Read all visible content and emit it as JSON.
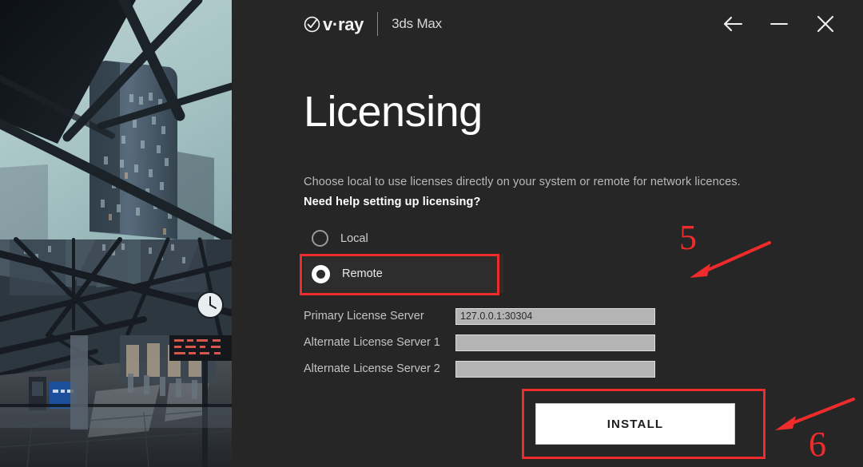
{
  "titlebar": {
    "brand_name": "v·ray",
    "brand_logo_icon": "vray-check-circle-icon",
    "product": "3ds Max",
    "back_icon": "back-arrow-icon",
    "minimize_icon": "minimize-icon",
    "close_icon": "close-icon"
  },
  "page": {
    "title": "Licensing",
    "description": "Choose local to use licenses directly on your system or remote for network licences.",
    "help_link": "Need help setting up licensing?"
  },
  "license_mode": {
    "options": [
      {
        "label": "Local",
        "selected": false
      },
      {
        "label": "Remote",
        "selected": true
      }
    ]
  },
  "servers": [
    {
      "label": "Primary License Server",
      "value": "127.0.0.1:30304",
      "placeholder": ""
    },
    {
      "label": "Alternate License Server 1",
      "value": "",
      "placeholder": ""
    },
    {
      "label": "Alternate License Server 2",
      "value": "",
      "placeholder": ""
    }
  ],
  "actions": {
    "install_label": "INSTALL"
  },
  "annotations": [
    {
      "id": "5",
      "label": "5",
      "target": "remote-radio"
    },
    {
      "id": "6",
      "label": "6",
      "target": "install-button"
    }
  ],
  "colors": {
    "panel_background": "#262626",
    "annotation_red": "#ef2b2b",
    "button_background": "#ffffff",
    "input_background": "#b4b4b4",
    "title_text": "#ffffff"
  }
}
